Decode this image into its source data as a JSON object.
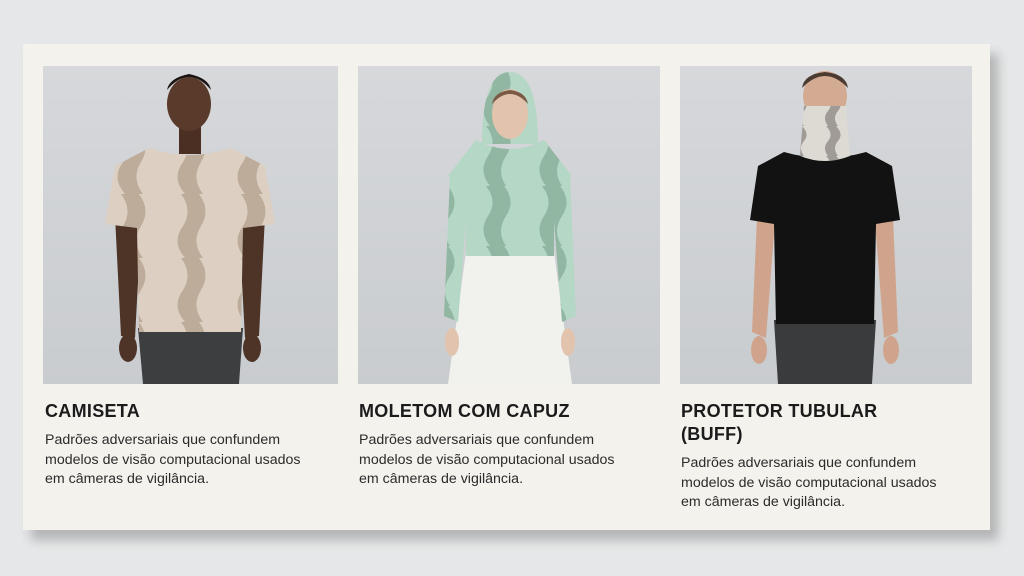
{
  "cards": [
    {
      "title": "CAMISETA",
      "description": "Padrões adversariais que confundem modelos de visão computacional usados em câmeras de vigilância.",
      "garment_color": "#d9c8b8",
      "pattern_color": "#b8a393"
    },
    {
      "title": "MOLETOM COM CAPUZ",
      "description": "Padrões adversariais que confundem modelos de visão computacional usados em câmeras de vigilância.",
      "garment_color": "#b4d6c4",
      "pattern_color": "#8fb7a3"
    },
    {
      "title": "PROTETOR TUBULAR (BUFF)",
      "description": "Padrões adversariais que confundem modelos de visão computacional usados em câmeras de vigilância.",
      "garment_color": "#d6d2cc",
      "pattern_color": "#9c9792"
    }
  ]
}
